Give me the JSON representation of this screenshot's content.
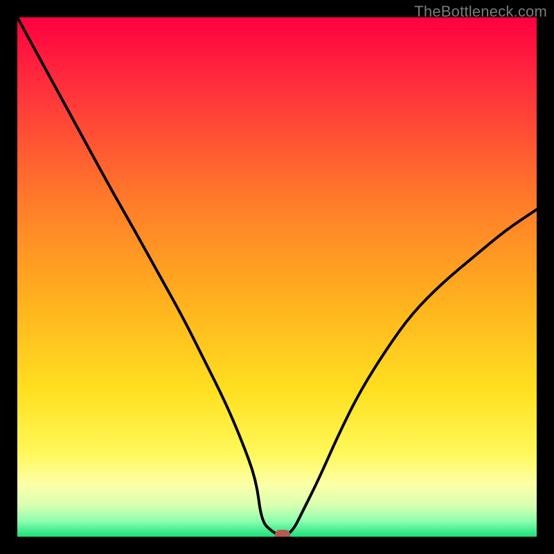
{
  "watermark": "TheBottleneck.com",
  "colors": {
    "frame": "#000000",
    "curve": "#000000",
    "marker": "#b65a51",
    "gradient_stops": [
      {
        "offset": 0,
        "color": "#ff0040"
      },
      {
        "offset": 12,
        "color": "#ff2b3d"
      },
      {
        "offset": 35,
        "color": "#ff7a2a"
      },
      {
        "offset": 55,
        "color": "#ffb21e"
      },
      {
        "offset": 72,
        "color": "#ffe020"
      },
      {
        "offset": 84,
        "color": "#fff85a"
      },
      {
        "offset": 90,
        "color": "#fcffa8"
      },
      {
        "offset": 94,
        "color": "#d8ffb0"
      },
      {
        "offset": 97,
        "color": "#8dffb0"
      },
      {
        "offset": 100,
        "color": "#18e07a"
      }
    ]
  },
  "chart_data": {
    "type": "line",
    "title": "",
    "xlabel": "",
    "ylabel": "",
    "xlim": [
      0,
      100
    ],
    "ylim": [
      0,
      100
    ],
    "optimum_x": 51,
    "flat_bottom_range": [
      47,
      53
    ],
    "right_endpoint": {
      "x": 100,
      "y": 63
    },
    "series": [
      {
        "name": "bottleneck-curve",
        "x": [
          0,
          6,
          12,
          18,
          22,
          27,
          32,
          36,
          40,
          43,
          46,
          47,
          49,
          51,
          53,
          55,
          58,
          62,
          66,
          71,
          76,
          82,
          88,
          94,
          100
        ],
        "y": [
          100,
          89,
          78,
          67,
          60,
          51,
          42,
          34,
          26,
          19,
          11,
          3,
          1,
          0,
          1,
          5,
          11,
          20,
          28,
          36,
          43,
          49,
          54,
          59,
          63
        ]
      }
    ]
  }
}
